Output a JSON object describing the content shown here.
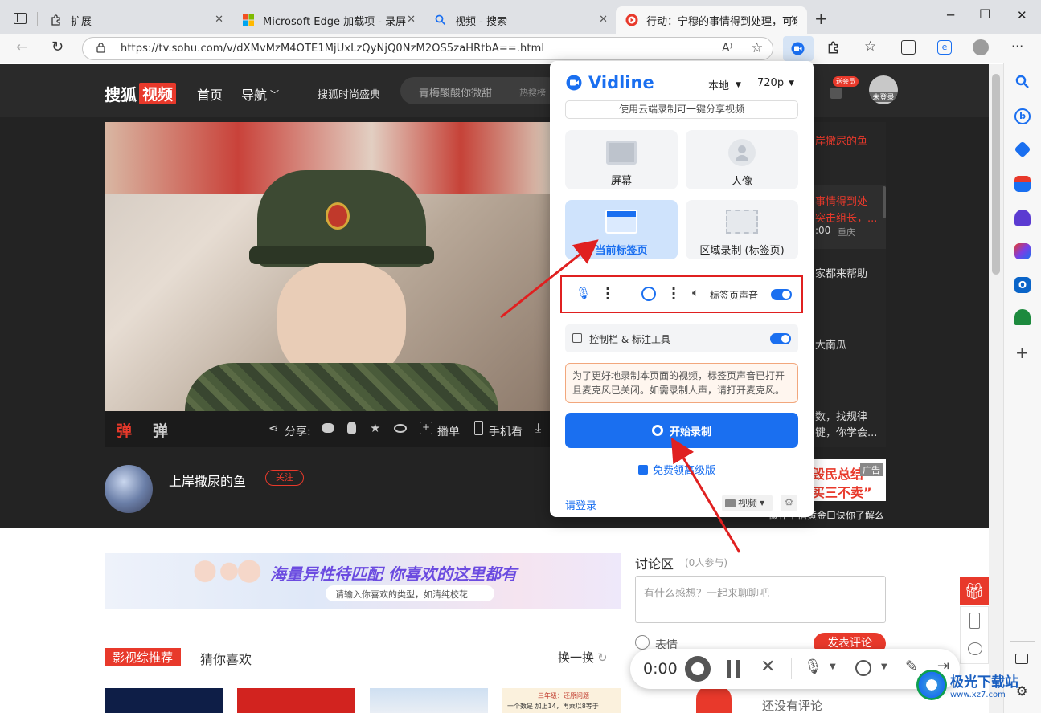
{
  "tabs": [
    {
      "label": "扩展",
      "icon": "puzzle-icon"
    },
    {
      "label": "Microsoft Edge 加载项 - 录屏",
      "icon": "microsoft-logo-icon"
    },
    {
      "label": "视频 - 搜索",
      "icon": "search-icon"
    },
    {
      "label": "行动：宁穆的事情得到处理，可以",
      "icon": "sohu-video-icon"
    }
  ],
  "address": {
    "url": "https://tv.sohu.com/v/dXMvMzM4OTE1MjUxLzQyNjQ0NzM2OS5zaHRtbA==.html"
  },
  "site": {
    "logo_text": "搜狐",
    "logo_badge": "视频",
    "nav_home": "首页",
    "nav_menu": "导航",
    "nav_event": "搜狐时尚盛典",
    "search_placeholder": "青梅酸酸你微甜",
    "hot_label": "热搜榜",
    "vip_badge": "送会员",
    "login_status": "未登录"
  },
  "video_bar": {
    "danmu1": "弹",
    "danmu2": "弹",
    "share": "分享:",
    "playlist": "播单",
    "mobile": "手机看"
  },
  "uploader": {
    "name": "上岸撒尿的鱼",
    "follow": "关注"
  },
  "side_list": [
    {
      "text": "岸撒尿的鱼",
      "color": "#e8392b"
    },
    {
      "text": "事情得到处",
      "color": "#e8392b"
    },
    {
      "text": "突击组长，...",
      "color": "#e8392b"
    },
    {
      "text": ":00",
      "color": "#ddd"
    },
    {
      "text": "重庆",
      "color": "#999"
    },
    {
      "text": "家都来帮助",
      "color": "#ddd"
    },
    {
      "text": "大南瓜",
      "color": "#ddd"
    },
    {
      "text": "数，找规律",
      "color": "#ddd"
    },
    {
      "text": "键，你学会...",
      "color": "#ddd"
    }
  ],
  "side_ad": {
    "line1": "毁民总结",
    "line2": "买三不卖”",
    "badge": "广告",
    "caption": "微补中借黄金口诀你了解么"
  },
  "vidline": {
    "brand": "Vidline",
    "mode": "本地",
    "quality": "720p",
    "cloud_tip": "使用云端录制可一键分享视频",
    "opt_screen": "屏幕",
    "opt_portrait": "人像",
    "opt_tab": "当前标签页",
    "opt_region": "区域录制 (标签页)",
    "tab_audio": "标签页声音",
    "toolbar_label": "控制栏 & 标注工具",
    "notice": "为了更好地录制本页面的视频，标签页声音已打开且麦克风已关闭。如需录制人声，请打开麦克风。",
    "start_btn": "开始录制",
    "upgrade": "免费领高级版",
    "login": "请登录",
    "format": "视频"
  },
  "banner": {
    "title": "海量异性待匹配 你喜欢的这里都有",
    "sub": "请输入你喜欢的类型，如清纯校花"
  },
  "discussion": {
    "title": "讨论区",
    "count": "(0人参与)",
    "placeholder": "有什么感想？一起来聊聊吧",
    "emoji": "表情",
    "submit": "发表评论",
    "empty": "还没有评论"
  },
  "recommend": {
    "tag": "影视综推荐",
    "tab2": "猜你喜欢",
    "refresh": "换一换"
  },
  "thumb_text": {
    "t1": "三年级：还原问题",
    "t2": "一个数是 加上14，再乘以8等于"
  },
  "rec_bar": {
    "time": "0:00"
  },
  "watermark": {
    "text": "极光下载站",
    "url": "www.xz7.com"
  },
  "colors": {
    "accent": "#1a6ff0",
    "sohu_red": "#e8392b",
    "annotation": "#e02020"
  }
}
